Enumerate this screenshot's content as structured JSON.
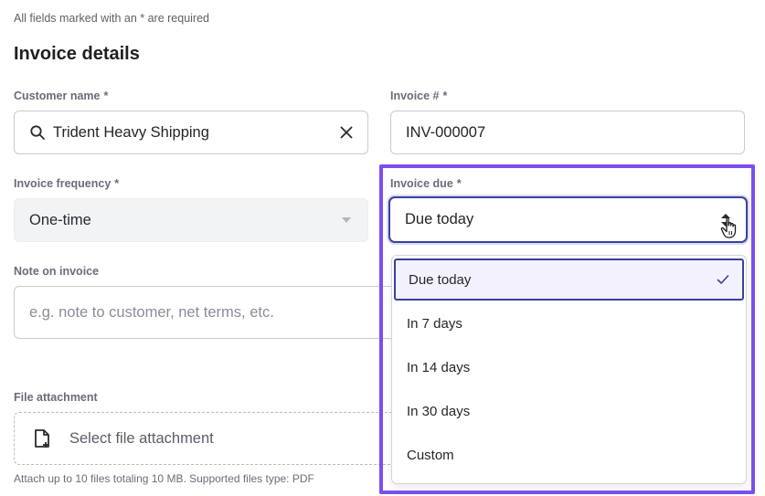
{
  "form": {
    "required_note": "All fields marked with an * are required",
    "section_title": "Invoice details",
    "required_marker": "*"
  },
  "customer": {
    "label": "Customer name",
    "value": "Trident Heavy Shipping",
    "icon": "search-icon",
    "clear_icon": "close-icon"
  },
  "invoice_number": {
    "label": "Invoice #",
    "value": "INV-000007"
  },
  "frequency": {
    "label": "Invoice frequency",
    "value": "One-time"
  },
  "invoice_due": {
    "label": "Invoice due",
    "value": "Due today",
    "options": [
      {
        "label": "Due today",
        "selected": true
      },
      {
        "label": "In 7 days",
        "selected": false
      },
      {
        "label": "In 14 days",
        "selected": false
      },
      {
        "label": "In 30 days",
        "selected": false
      },
      {
        "label": "Custom",
        "selected": false
      }
    ]
  },
  "note": {
    "label": "Note on invoice",
    "placeholder": "e.g. note to customer, net terms, etc."
  },
  "attachment": {
    "label": "File attachment",
    "button_label": "Select file attachment",
    "help_text": "Attach up to 10 files totaling 10 MB. Supported files type: PDF"
  },
  "colors": {
    "highlight": "#7b4ff0",
    "focus_border": "#3b3f9e",
    "selected_bg": "#f3f1fd"
  }
}
